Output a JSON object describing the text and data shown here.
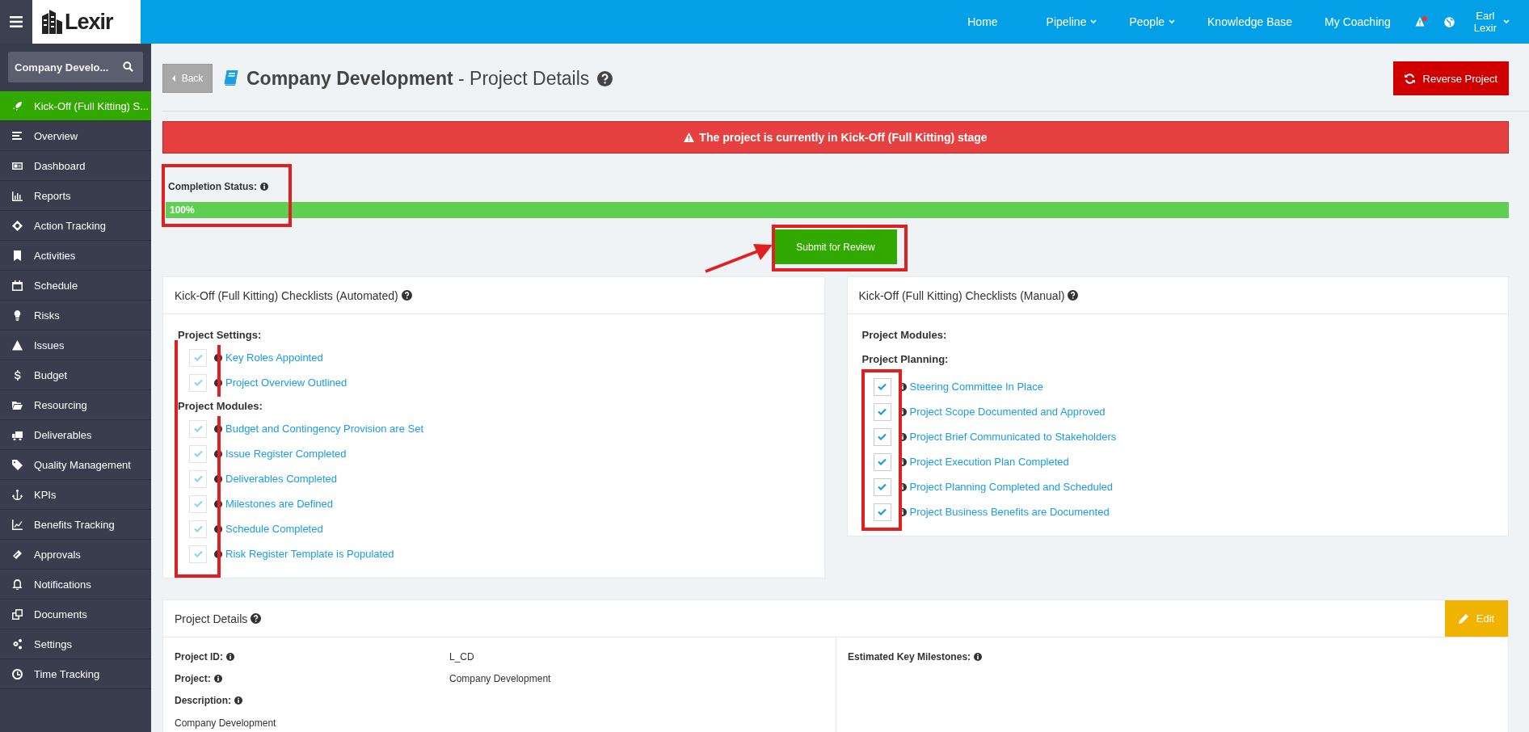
{
  "topbar": {
    "logo_text": "Lexir",
    "nav": [
      {
        "label": "Home",
        "dropdown": false
      },
      {
        "label": "Pipeline",
        "dropdown": true
      },
      {
        "label": "People",
        "dropdown": true
      },
      {
        "label": "Knowledge Base",
        "dropdown": false
      },
      {
        "label": "My Coaching",
        "dropdown": false
      }
    ],
    "alert_unread": true,
    "user_first": "Earl",
    "user_last": "Lexir"
  },
  "sidebar": {
    "search": {
      "value": "Company Develo..."
    },
    "items": [
      {
        "label": "Kick-Off (Full Kitting) S...",
        "selected": true
      },
      {
        "label": "Overview",
        "selected": false
      },
      {
        "label": "Dashboard",
        "selected": false
      },
      {
        "label": "Reports",
        "selected": false
      },
      {
        "label": "Action Tracking",
        "selected": false
      },
      {
        "label": "Activities",
        "selected": false
      },
      {
        "label": "Schedule",
        "selected": false
      },
      {
        "label": "Risks",
        "selected": false
      },
      {
        "label": "Issues",
        "selected": false
      },
      {
        "label": "Budget",
        "selected": false
      },
      {
        "label": "Resourcing",
        "selected": false
      },
      {
        "label": "Deliverables",
        "selected": false
      },
      {
        "label": "Quality Management",
        "selected": false
      },
      {
        "label": "KPIs",
        "selected": false
      },
      {
        "label": "Benefits Tracking",
        "selected": false
      },
      {
        "label": "Approvals",
        "selected": false
      },
      {
        "label": "Notifications",
        "selected": false
      },
      {
        "label": "Documents",
        "selected": false
      },
      {
        "label": "Settings",
        "selected": false
      },
      {
        "label": "Time Tracking",
        "selected": false
      }
    ]
  },
  "header": {
    "back": "Back",
    "title": "Company Development",
    "subtitle": "- Project Details",
    "reverse_button": "Reverse Project"
  },
  "alert": "The project is currently in Kick-Off (Full Kitting) stage",
  "completion": {
    "label": "Completion Status:",
    "level": 1,
    "text": "100%"
  },
  "submit_button": "Submit for Review",
  "checklists": [
    {
      "title": "Kick-Off (Full Kitting) Checklists (Automated)",
      "sections": [
        {
          "heading": "Project Settings:",
          "items": [
            {
              "label": "Key Roles Appointed",
              "checked": true,
              "disabled": true
            },
            {
              "label": "Project Overview Outlined",
              "checked": true,
              "disabled": true
            }
          ]
        },
        {
          "heading": "Project Modules:",
          "items": [
            {
              "label": "Budget and Contingency Provision are Set",
              "checked": true,
              "disabled": true
            },
            {
              "label": "Issue Register Completed",
              "checked": true,
              "disabled": true
            },
            {
              "label": "Deliverables Completed",
              "checked": true,
              "disabled": true
            },
            {
              "label": "Milestones are Defined",
              "checked": true,
              "disabled": true
            },
            {
              "label": "Schedule Completed",
              "checked": true,
              "disabled": true
            },
            {
              "label": "Risk Register Template is Populated",
              "checked": true,
              "disabled": true
            }
          ]
        }
      ]
    },
    {
      "title": "Kick-Off (Full Kitting) Checklists (Manual)",
      "sections": [
        {
          "heading": "Project Modules:"
        },
        {
          "heading": "Project Planning:",
          "items": [
            {
              "label": "Steering Committee In Place",
              "checked": true,
              "disabled": false
            },
            {
              "label": "Project Scope Documented and Approved",
              "checked": true,
              "disabled": false
            },
            {
              "label": "Project Brief Communicated to Stakeholders",
              "checked": true,
              "disabled": false
            },
            {
              "label": "Project Execution Plan Completed",
              "checked": true,
              "disabled": false
            },
            {
              "label": "Project Planning Completed and Scheduled",
              "checked": true,
              "disabled": false
            },
            {
              "label": "Project Business Benefits are Documented",
              "checked": true,
              "disabled": false
            }
          ]
        }
      ]
    }
  ],
  "project_details": {
    "title": "Project Details",
    "edit_button": "Edit",
    "fields": [
      {
        "label": "Project ID:",
        "value": "L_CD"
      },
      {
        "label": "Project:",
        "value": "Company Development"
      }
    ],
    "description_label": "Description:",
    "description": "Company Development",
    "milestones_label": "Estimated Key Milestones:"
  }
}
